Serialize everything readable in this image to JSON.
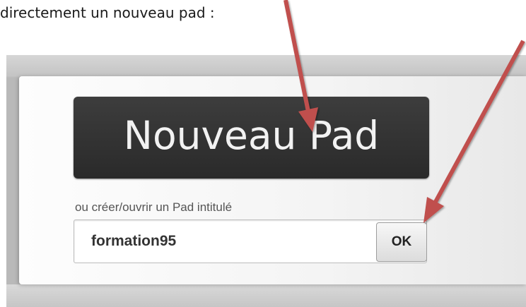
{
  "document": {
    "intro_text": "directement un nouveau pad :"
  },
  "etherpad": {
    "new_pad_label": "Nouveau Pad",
    "open_label": "ou créer/ouvrir un Pad intitulé",
    "pad_name_value": "formation95",
    "ok_label": "OK"
  },
  "annotations": {
    "arrow_color": "#c0504d",
    "arrows": [
      "new-pad-arrow",
      "ok-arrow"
    ]
  }
}
